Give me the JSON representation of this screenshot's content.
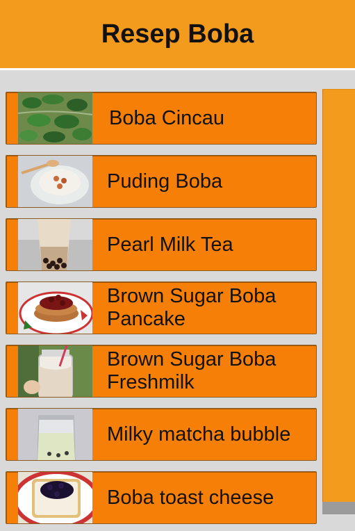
{
  "header": {
    "title": "Resep Boba"
  },
  "recipes": [
    {
      "label": "Boba Cincau",
      "image": "green-jelly-drink-photo"
    },
    {
      "label": "Puding Boba",
      "image": "boba-pudding-photo"
    },
    {
      "label": "Pearl Milk Tea",
      "image": "pearl-milk-tea-photo"
    },
    {
      "label": "Brown Sugar Boba Pancake",
      "image": "boba-pancake-photo"
    },
    {
      "label": "Brown Sugar Boba Freshmilk",
      "image": "boba-freshmilk-photo"
    },
    {
      "label": "Milky matcha bubble",
      "image": "matcha-bubble-photo"
    },
    {
      "label": "Boba toast cheese",
      "image": "boba-toast-photo"
    }
  ],
  "colors": {
    "header": "#f39b1d",
    "item": "#f68007",
    "background": "#d9d9d9",
    "scrollbar": "#f39b1d"
  }
}
